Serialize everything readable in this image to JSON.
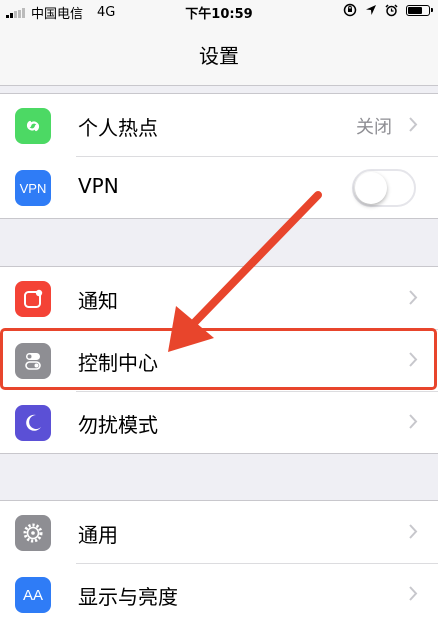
{
  "status_bar": {
    "carrier": "中国电信",
    "network": "4G",
    "time": "下午10:59",
    "signal_bars": 5,
    "signal_bars_filled": 2,
    "battery_level": 0.75
  },
  "nav": {
    "title": "设置"
  },
  "groups": [
    {
      "rows": [
        {
          "label": "个人热点",
          "value": "关闭",
          "icon": "hotspot-icon",
          "icon_color": "#4cd964"
        },
        {
          "label": "VPN",
          "icon_text": "VPN",
          "icon": "vpn-icon",
          "icon_color": "#2f7cf6",
          "toggle": false
        }
      ]
    },
    {
      "rows": [
        {
          "label": "通知",
          "icon": "notifications-icon",
          "icon_color": "#f44336"
        },
        {
          "label": "控制中心",
          "icon": "control-center-icon",
          "icon_color": "#8e8e93",
          "highlighted": true
        },
        {
          "label": "勿扰模式",
          "icon": "moon-icon",
          "icon_color": "#5b50d6"
        }
      ]
    },
    {
      "rows": [
        {
          "label": "通用",
          "icon": "gear-icon",
          "icon_color": "#8e8e93"
        },
        {
          "label": "显示与亮度",
          "icon_text": "AA",
          "icon": "display-icon",
          "icon_color": "#2f7cf6"
        }
      ]
    }
  ],
  "annotation": {
    "color": "#e8452c",
    "arrow": "pointing-to-control-center"
  }
}
